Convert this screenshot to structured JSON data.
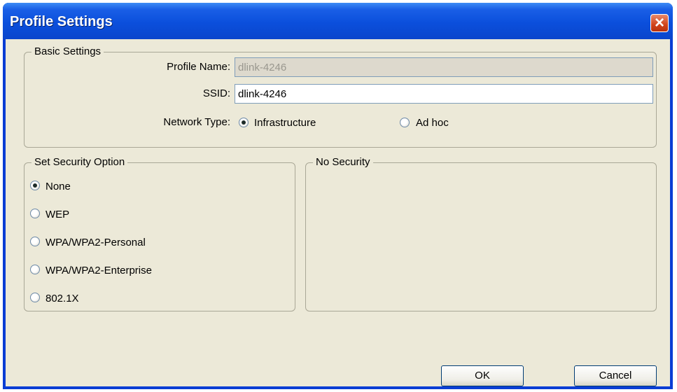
{
  "window": {
    "title": "Profile Settings"
  },
  "basic_settings": {
    "legend": "Basic Settings",
    "profile_name_label": "Profile Name:",
    "profile_name_value": "dlink-4246",
    "ssid_label": "SSID:",
    "ssid_value": "dlink-4246",
    "network_type_label": "Network Type:",
    "network_types": [
      {
        "label": "Infrastructure",
        "checked": true
      },
      {
        "label": "Ad hoc",
        "checked": false
      }
    ]
  },
  "security_option": {
    "legend": "Set Security Option",
    "options": [
      {
        "label": "None",
        "checked": true
      },
      {
        "label": "WEP",
        "checked": false
      },
      {
        "label": "WPA/WPA2-Personal",
        "checked": false
      },
      {
        "label": "WPA/WPA2-Enterprise",
        "checked": false
      },
      {
        "label": "802.1X",
        "checked": false
      }
    ]
  },
  "security_detail": {
    "legend": "No Security"
  },
  "buttons": {
    "ok": "OK",
    "cancel": "Cancel"
  },
  "colors": {
    "titlebar": "#0a45cc",
    "dialog_bg": "#ece9d8",
    "close_button": "#d0431b"
  }
}
